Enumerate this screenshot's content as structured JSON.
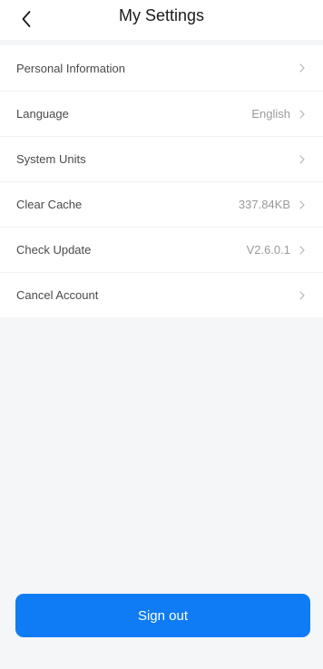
{
  "header": {
    "title": "My Settings",
    "back_icon": "chevron-left-icon"
  },
  "settings": {
    "items": [
      {
        "label": "Personal Information",
        "value": ""
      },
      {
        "label": "Language",
        "value": "English"
      },
      {
        "label": "System Units",
        "value": ""
      },
      {
        "label": "Clear Cache",
        "value": "337.84KB"
      },
      {
        "label": "Check Update",
        "value": "V2.6.0.1"
      },
      {
        "label": "Cancel Account",
        "value": ""
      }
    ]
  },
  "actions": {
    "sign_out_label": "Sign out"
  },
  "colors": {
    "accent": "#0f7cf5",
    "background": "#f5f6f7",
    "surface": "#ffffff"
  }
}
